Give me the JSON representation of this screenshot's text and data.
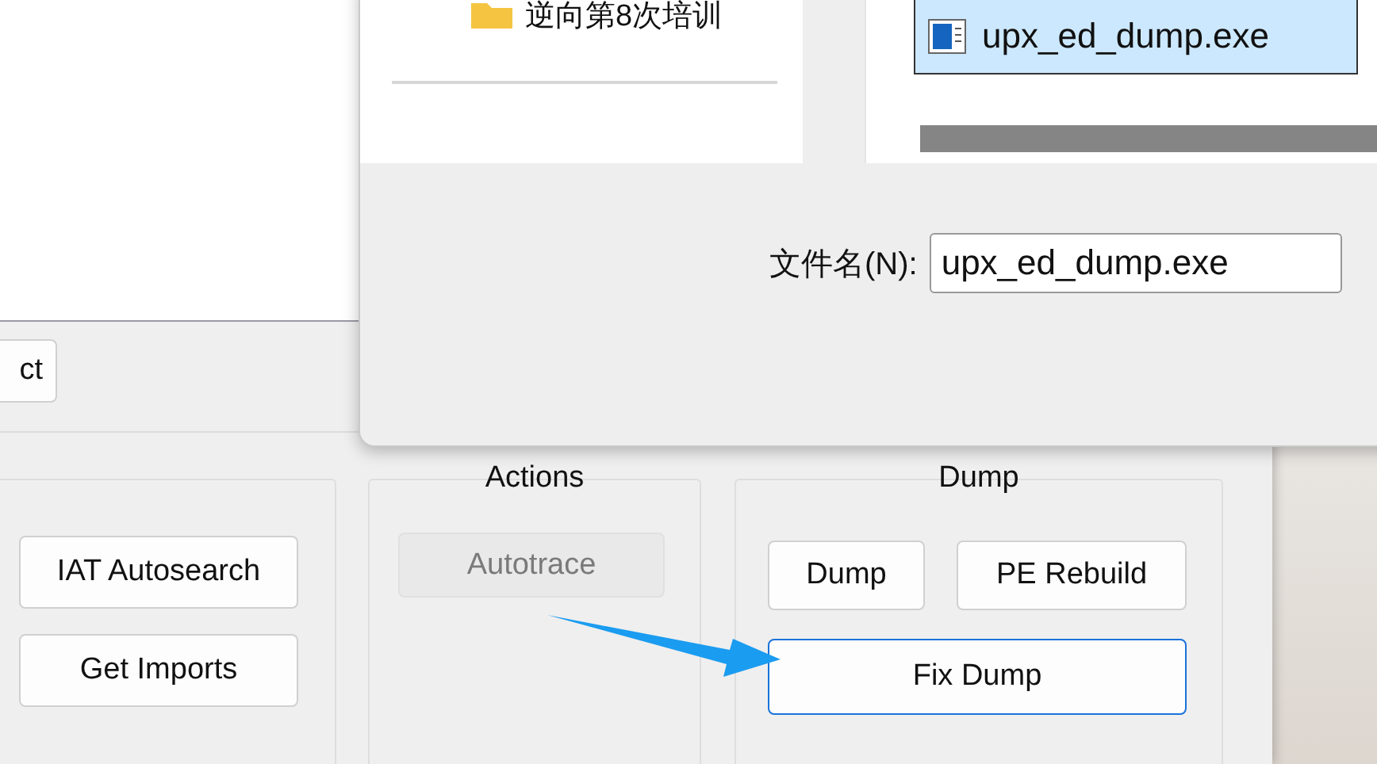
{
  "main_window": {
    "cut_button": {
      "label": "ct"
    },
    "groups": [
      {
        "buttons": [
          {
            "label": "IAT Autosearch",
            "disabled": false,
            "focused": false
          },
          {
            "label": "Get Imports",
            "disabled": false,
            "focused": false
          }
        ]
      },
      {
        "title": "Actions",
        "buttons": [
          {
            "label": "Autotrace",
            "disabled": true,
            "focused": false
          }
        ]
      },
      {
        "title": "Dump",
        "buttons": [
          {
            "label": "Dump",
            "disabled": false,
            "focused": false
          },
          {
            "label": "PE Rebuild",
            "disabled": false,
            "focused": false
          },
          {
            "label": "Fix Dump",
            "disabled": false,
            "focused": true
          }
        ]
      }
    ]
  },
  "save_dialog": {
    "nav_items": [
      {
        "label": "逆向第8次培训"
      }
    ],
    "files": [
      {
        "name": "upx_ed_dump.exe",
        "selected": true
      }
    ],
    "filename": {
      "label": "文件名(N):",
      "value": "upx_ed_dump.exe"
    }
  }
}
